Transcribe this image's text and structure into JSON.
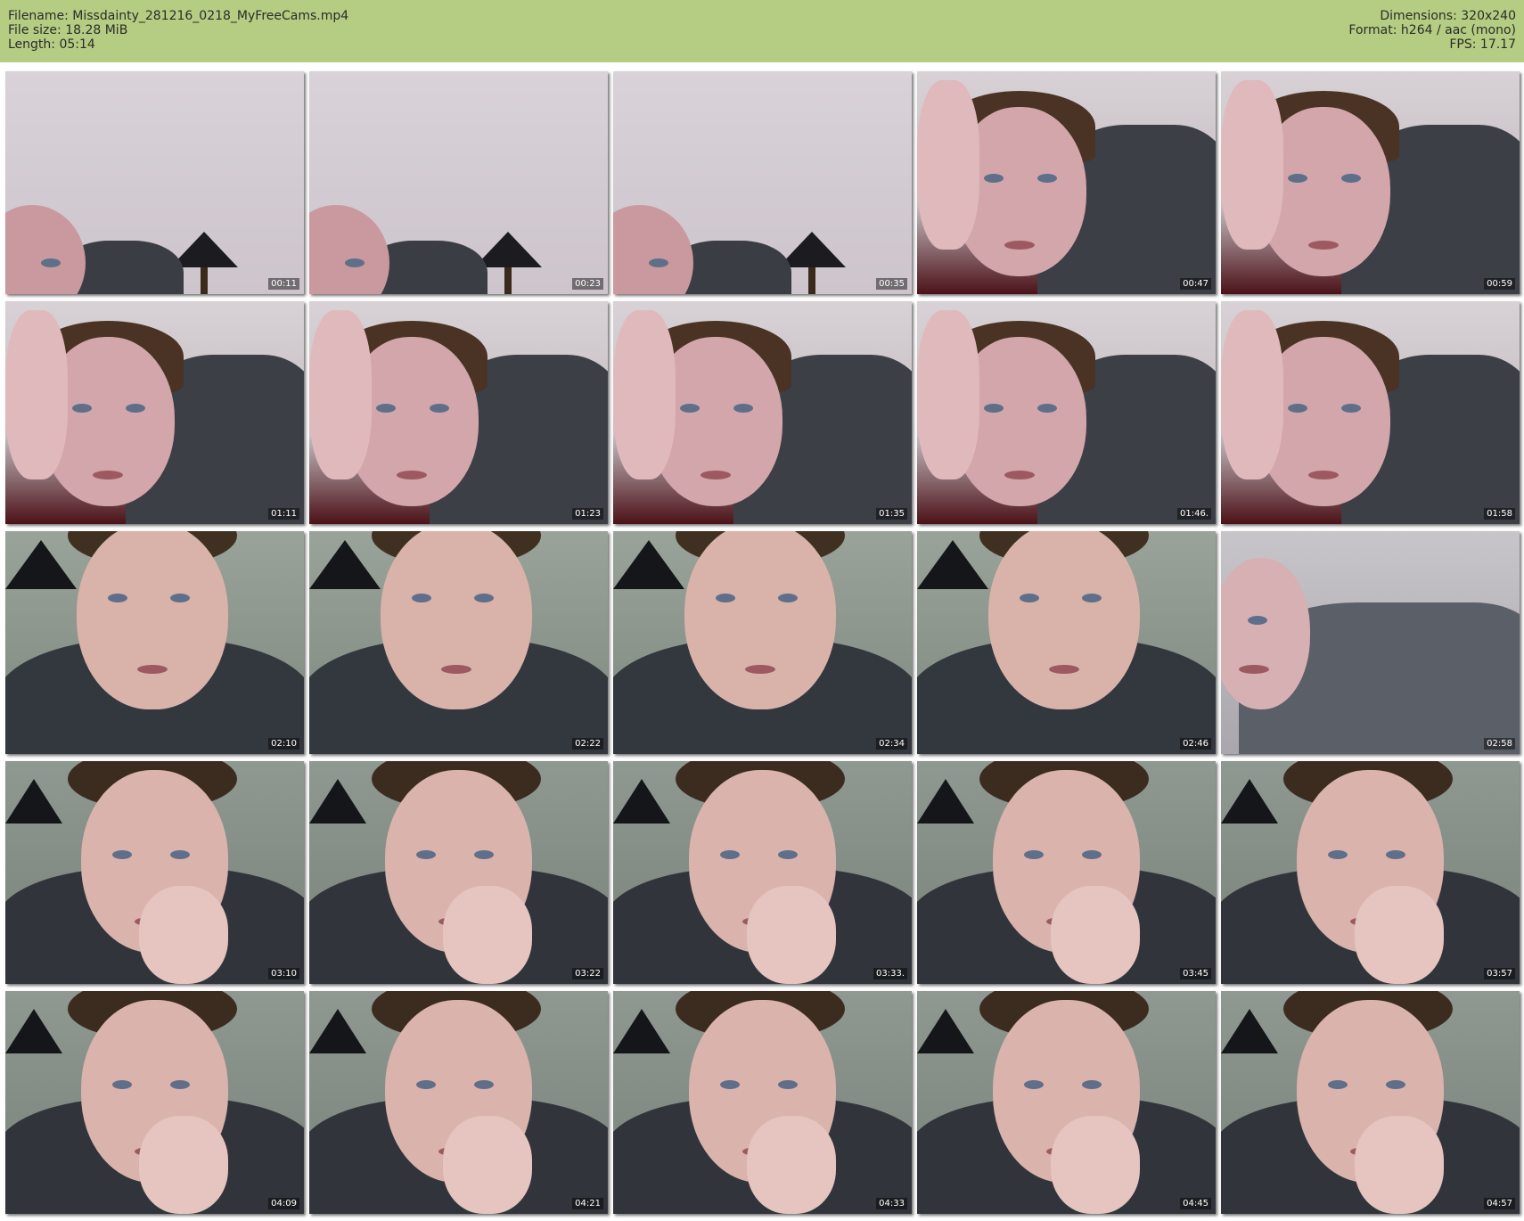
{
  "header": {
    "left": [
      "Filename: Missdainty_281216_0218_MyFreeCams.mp4",
      "File size: 18.28 MiB",
      "Length: 05:14"
    ],
    "right": [
      "Dimensions: 320x240",
      "Format: h264 / aac (mono)",
      "FPS: 17.17"
    ],
    "background": "#b5cd82"
  },
  "thumbnails": [
    {
      "time": "00:11",
      "scene": "wall"
    },
    {
      "time": "00:23",
      "scene": "wall"
    },
    {
      "time": "00:35",
      "scene": "wall"
    },
    {
      "time": "00:47",
      "scene": "couch"
    },
    {
      "time": "00:59",
      "scene": "couch"
    },
    {
      "time": "01:11",
      "scene": "couch"
    },
    {
      "time": "01:23",
      "scene": "couch"
    },
    {
      "time": "01:35",
      "scene": "couch"
    },
    {
      "time": "01:46.",
      "scene": "couch"
    },
    {
      "time": "01:58",
      "scene": "couch"
    },
    {
      "time": "02:10",
      "scene": "green"
    },
    {
      "time": "02:22",
      "scene": "green"
    },
    {
      "time": "02:34",
      "scene": "green"
    },
    {
      "time": "02:46",
      "scene": "green"
    },
    {
      "time": "02:58",
      "scene": "gray"
    },
    {
      "time": "03:10",
      "scene": "chin"
    },
    {
      "time": "03:22",
      "scene": "chin"
    },
    {
      "time": "03:33.",
      "scene": "chin"
    },
    {
      "time": "03:45",
      "scene": "chin"
    },
    {
      "time": "03:57",
      "scene": "chin"
    },
    {
      "time": "04:09",
      "scene": "chin"
    },
    {
      "time": "04:21",
      "scene": "chin"
    },
    {
      "time": "04:33",
      "scene": "chin"
    },
    {
      "time": "04:45",
      "scene": "chin"
    },
    {
      "time": "04:57",
      "scene": "chin"
    }
  ]
}
